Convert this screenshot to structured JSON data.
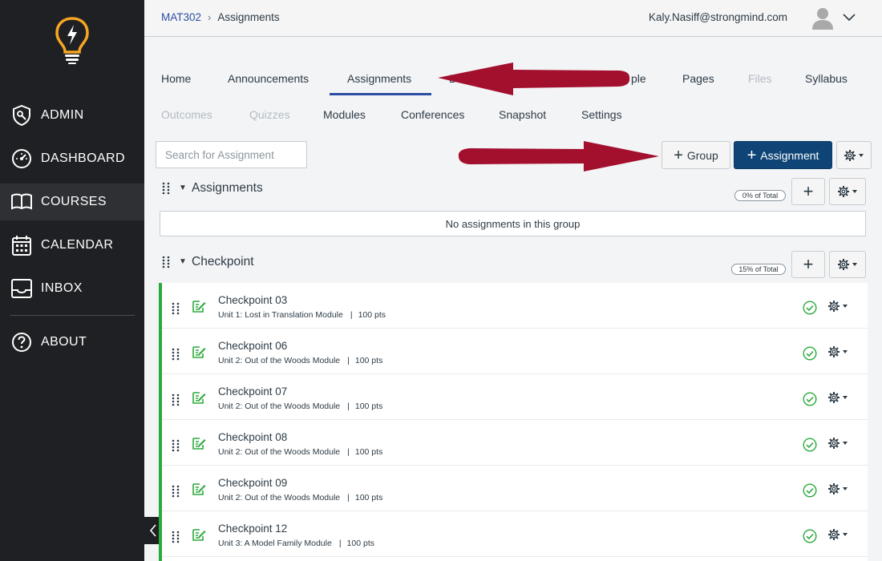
{
  "sidebar": {
    "items": [
      {
        "label": "ADMIN",
        "icon": "admin-shield-icon"
      },
      {
        "label": "DASHBOARD",
        "icon": "speedometer-icon"
      },
      {
        "label": "COURSES",
        "icon": "book-icon",
        "active": true
      },
      {
        "label": "CALENDAR",
        "icon": "calendar-icon"
      },
      {
        "label": "INBOX",
        "icon": "inbox-icon"
      },
      {
        "label": "ABOUT",
        "icon": "help-icon"
      }
    ]
  },
  "header": {
    "breadcrumb_course": "MAT302",
    "breadcrumb_sep": "›",
    "breadcrumb_current": "Assignments",
    "user_email": "Kaly.Nasiff@strongmind.com"
  },
  "tabs": {
    "row1": [
      "Home",
      "Announcements",
      "Assignments",
      "D",
      "ple",
      "Pages",
      "Files",
      "Syllabus"
    ],
    "row2": [
      "Outcomes",
      "Quizzes",
      "Modules",
      "Conferences",
      "Snapshot",
      "Settings"
    ]
  },
  "toolbar": {
    "search_placeholder": "Search for Assignment",
    "group_button": "Group",
    "assignment_button": "Assignment"
  },
  "groups": [
    {
      "title": "Assignments",
      "percent": "0% of Total",
      "empty_text": "No assignments in this group"
    },
    {
      "title": "Checkpoint",
      "percent": "15% of Total"
    }
  ],
  "assignments": [
    {
      "title": "Checkpoint 03",
      "module": "Unit 1: Lost in Translation Module",
      "points": "100 pts"
    },
    {
      "title": "Checkpoint 06",
      "module": "Unit 2: Out of the Woods Module",
      "points": "100 pts"
    },
    {
      "title": "Checkpoint 07",
      "module": "Unit 2: Out of the Woods Module",
      "points": "100 pts"
    },
    {
      "title": "Checkpoint 08",
      "module": "Unit 2: Out of the Woods Module",
      "points": "100 pts"
    },
    {
      "title": "Checkpoint 09",
      "module": "Unit 2: Out of the Woods Module",
      "points": "100 pts"
    },
    {
      "title": "Checkpoint 12",
      "module": "Unit 3: A Model Family Module",
      "points": "100 pts"
    }
  ],
  "meta_separator": "|",
  "colors": {
    "sidebar_bg": "#1f2023",
    "link_blue": "#2b4ea3",
    "primary_button": "#0f4576",
    "published_green": "#2baa3c",
    "annotation_arrow": "#a3102e"
  }
}
